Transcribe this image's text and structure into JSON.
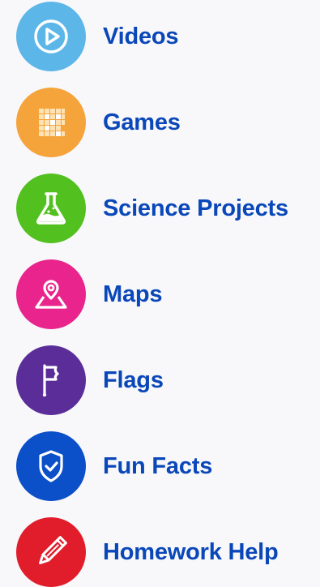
{
  "menu": {
    "items": [
      {
        "label": "Videos",
        "icon": "play-icon",
        "color": "#5cb6e8"
      },
      {
        "label": "Games",
        "icon": "crossword-icon",
        "color": "#f5a43b"
      },
      {
        "label": "Science Projects",
        "icon": "flask-icon",
        "color": "#52c11f"
      },
      {
        "label": "Maps",
        "icon": "map-pin-icon",
        "color": "#e9248c"
      },
      {
        "label": "Flags",
        "icon": "flag-icon",
        "color": "#5b2d99"
      },
      {
        "label": "Fun Facts",
        "icon": "shield-check-icon",
        "color": "#0b4fc9"
      },
      {
        "label": "Homework Help",
        "icon": "pencil-icon",
        "color": "#e11d2b"
      }
    ],
    "label_color": "#0a47b8"
  }
}
